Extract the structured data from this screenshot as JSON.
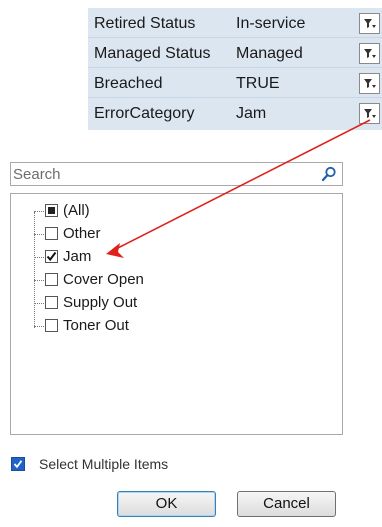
{
  "pivot": {
    "rows": [
      {
        "label": "Retired Status",
        "value": "In-service"
      },
      {
        "label": "Managed Status",
        "value": "Managed"
      },
      {
        "label": "Breached",
        "value": "TRUE"
      },
      {
        "label": "ErrorCategory",
        "value": "Jam"
      }
    ],
    "filter_icon": "filter-dropdown-icon"
  },
  "search": {
    "placeholder": "Search",
    "value": "",
    "icon": "search-icon"
  },
  "tree": {
    "items": [
      {
        "label": "(All)",
        "state": "partial"
      },
      {
        "label": "Other",
        "state": "unchecked"
      },
      {
        "label": "Jam",
        "state": "checked"
      },
      {
        "label": "Cover Open",
        "state": "unchecked"
      },
      {
        "label": "Supply Out",
        "state": "unchecked"
      },
      {
        "label": "Toner Out",
        "state": "unchecked"
      }
    ]
  },
  "select_multiple": {
    "label": "Select Multiple Items",
    "checked": true
  },
  "buttons": {
    "ok_label": "OK",
    "cancel_label": "Cancel"
  },
  "colors": {
    "pivot_background": "#dce6f1",
    "annotation_arrow": "#e0201b",
    "checkbox_accent": "#1f63c8"
  }
}
